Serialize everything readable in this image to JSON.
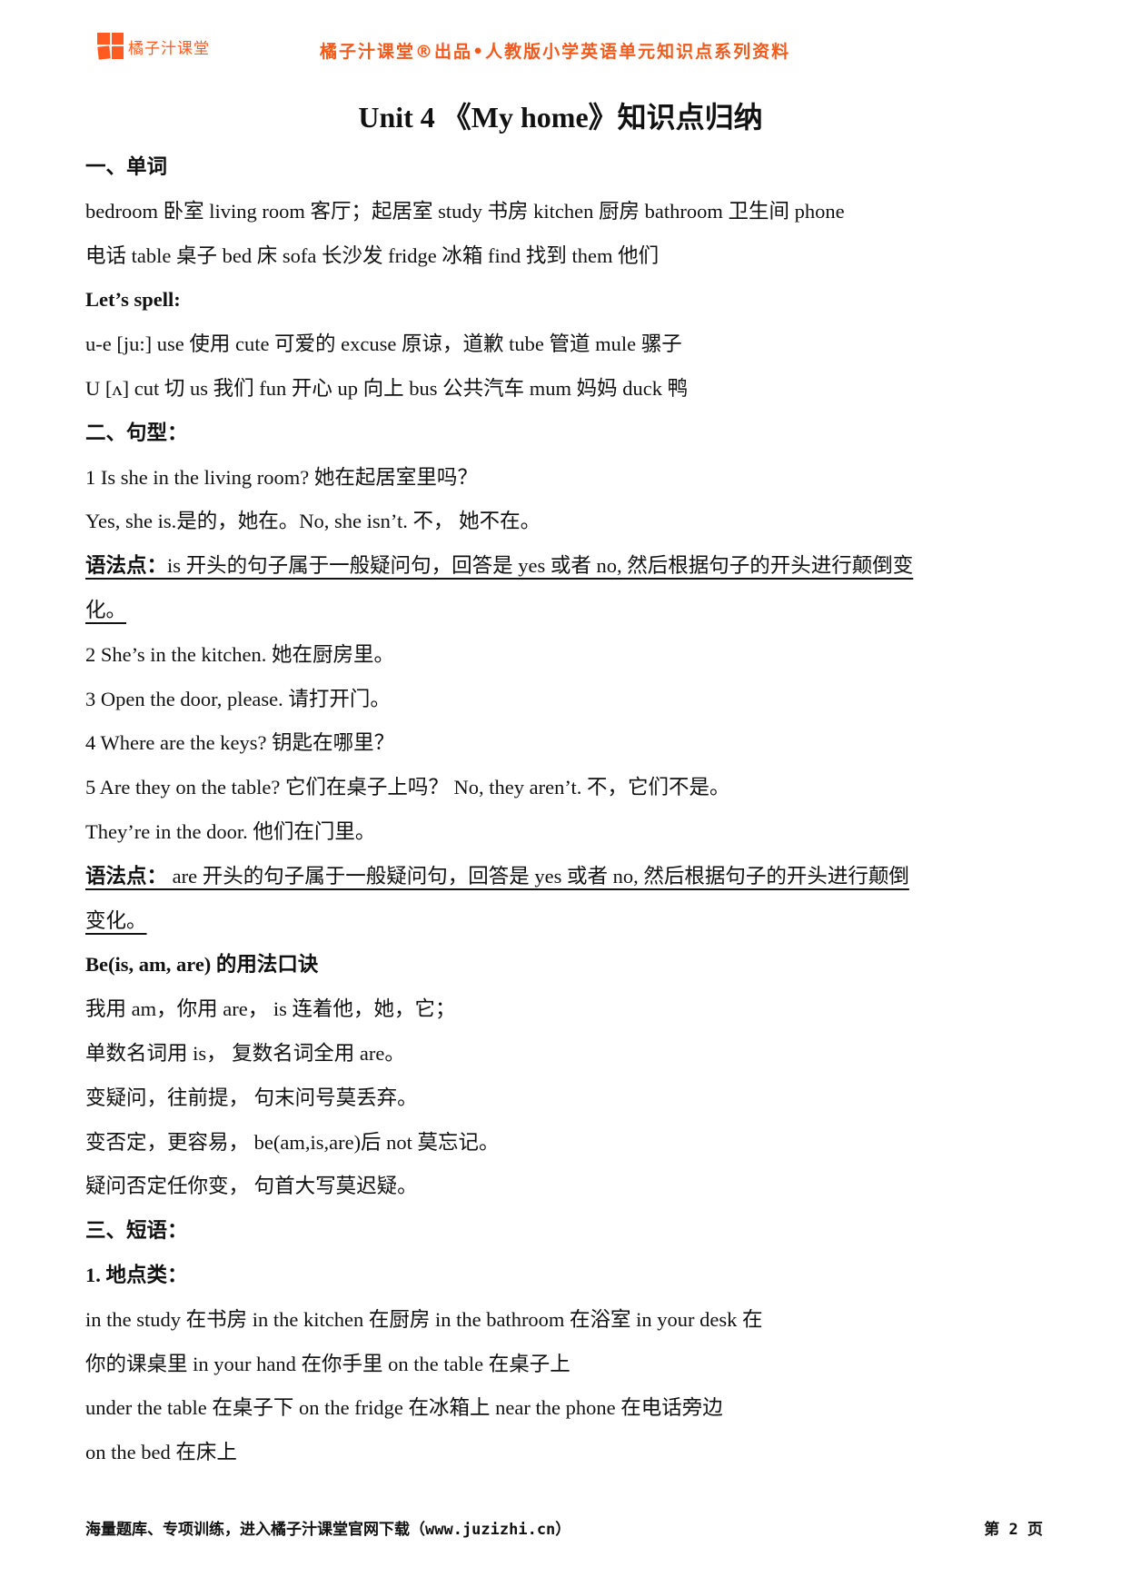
{
  "header": {
    "logo_text": "橘子汁课堂",
    "title": "橘子汁课堂®出品•人教版小学英语单元知识点系列资料",
    "brand_color": "#ff5a1f"
  },
  "document": {
    "title": "Unit 4 《My home》知识点归纳",
    "lines": [
      {
        "style": "heading",
        "text": "一、单词"
      },
      {
        "style": "normal",
        "text": "bedroom 卧室  living room 客厅；起居室  study 书房  kitchen 厨房  bathroom 卫生间  phone"
      },
      {
        "style": "normal",
        "text": "电话  table 桌子  bed 床  sofa 长沙发  fridge 冰箱  find 找到  them 他们"
      },
      {
        "style": "heading",
        "text": "Let’s    spell:"
      },
      {
        "style": "normal",
        "text": "u-e [ju:] use 使用  cute 可爱的  excuse 原谅，道歉  tube 管道  mule 骡子"
      },
      {
        "style": "normal",
        "text": "U    [ʌ] cut 切  us 我们  fun 开心  up 向上  bus 公共汽车  mum 妈妈  duck 鸭"
      },
      {
        "style": "heading",
        "text": "二、句型："
      },
      {
        "style": "normal",
        "text": "1 Is she in the living room?  她在起居室里吗？"
      },
      {
        "style": "normal",
        "text": "Yes, she is.是的，她在。No, she isn’t. 不，  她不在。"
      },
      {
        "style": "grammar",
        "label": "语法点：",
        "text": "is 开头的句子属于一般疑问句，回答是 yes 或者 no, 然后根据句子的开头进行颠倒变"
      },
      {
        "style": "grammar-cont",
        "text": "化。"
      },
      {
        "style": "normal",
        "text": "2 She’s in the kitchen.  她在厨房里。"
      },
      {
        "style": "normal",
        "text": "3 Open the door, please.  请打开门。"
      },
      {
        "style": "normal",
        "text": "4 Where are the keys?  钥匙在哪里？"
      },
      {
        "style": "normal",
        "text": "5 Are they on the table?  它们在桌子上吗？   No, they aren’t.  不，它们不是。"
      },
      {
        "style": "normal",
        "text": "They’re in the door.  他们在门里。"
      },
      {
        "style": "grammar",
        "label": "语法点：",
        "text": "  are 开头的句子属于一般疑问句，回答是 yes 或者 no, 然后根据句子的开头进行颠倒"
      },
      {
        "style": "grammar-cont",
        "text": "变化。"
      },
      {
        "style": "heading",
        "text": "Be(is, am, are)   的用法口诀"
      },
      {
        "style": "normal",
        "text": "我用 am，你用 are，  is 连着他，她，它；"
      },
      {
        "style": "normal",
        "text": "单数名词用 is，  复数名词全用 are。"
      },
      {
        "style": "normal",
        "text": "变疑问，往前提，  句末问号莫丢弃。"
      },
      {
        "style": "normal",
        "text": "变否定，更容易，  be(am,is,are)后  not 莫忘记。"
      },
      {
        "style": "normal",
        "text": "疑问否定任你变，  句首大写莫迟疑。"
      },
      {
        "style": "heading",
        "text": "三、短语："
      },
      {
        "style": "heading",
        "text": "1.   地点类："
      },
      {
        "style": "normal",
        "text": "in the study  在书房  in the kitchen  在厨房  in the bathroom  在浴室  in your desk  在"
      },
      {
        "style": "normal",
        "text": "你的课桌里  in your hand  在你手里  on the table  在桌子上"
      },
      {
        "style": "normal",
        "text": "under the table  在桌子下  on the fridge  在冰箱上  near the phone  在电话旁边"
      },
      {
        "style": "normal",
        "text": "on the bed  在床上"
      }
    ]
  },
  "footer": {
    "text": "海量题库、专项训练，进入橘子汁课堂官网下载（www.juzizhi.cn）",
    "page": "第 2 页"
  }
}
